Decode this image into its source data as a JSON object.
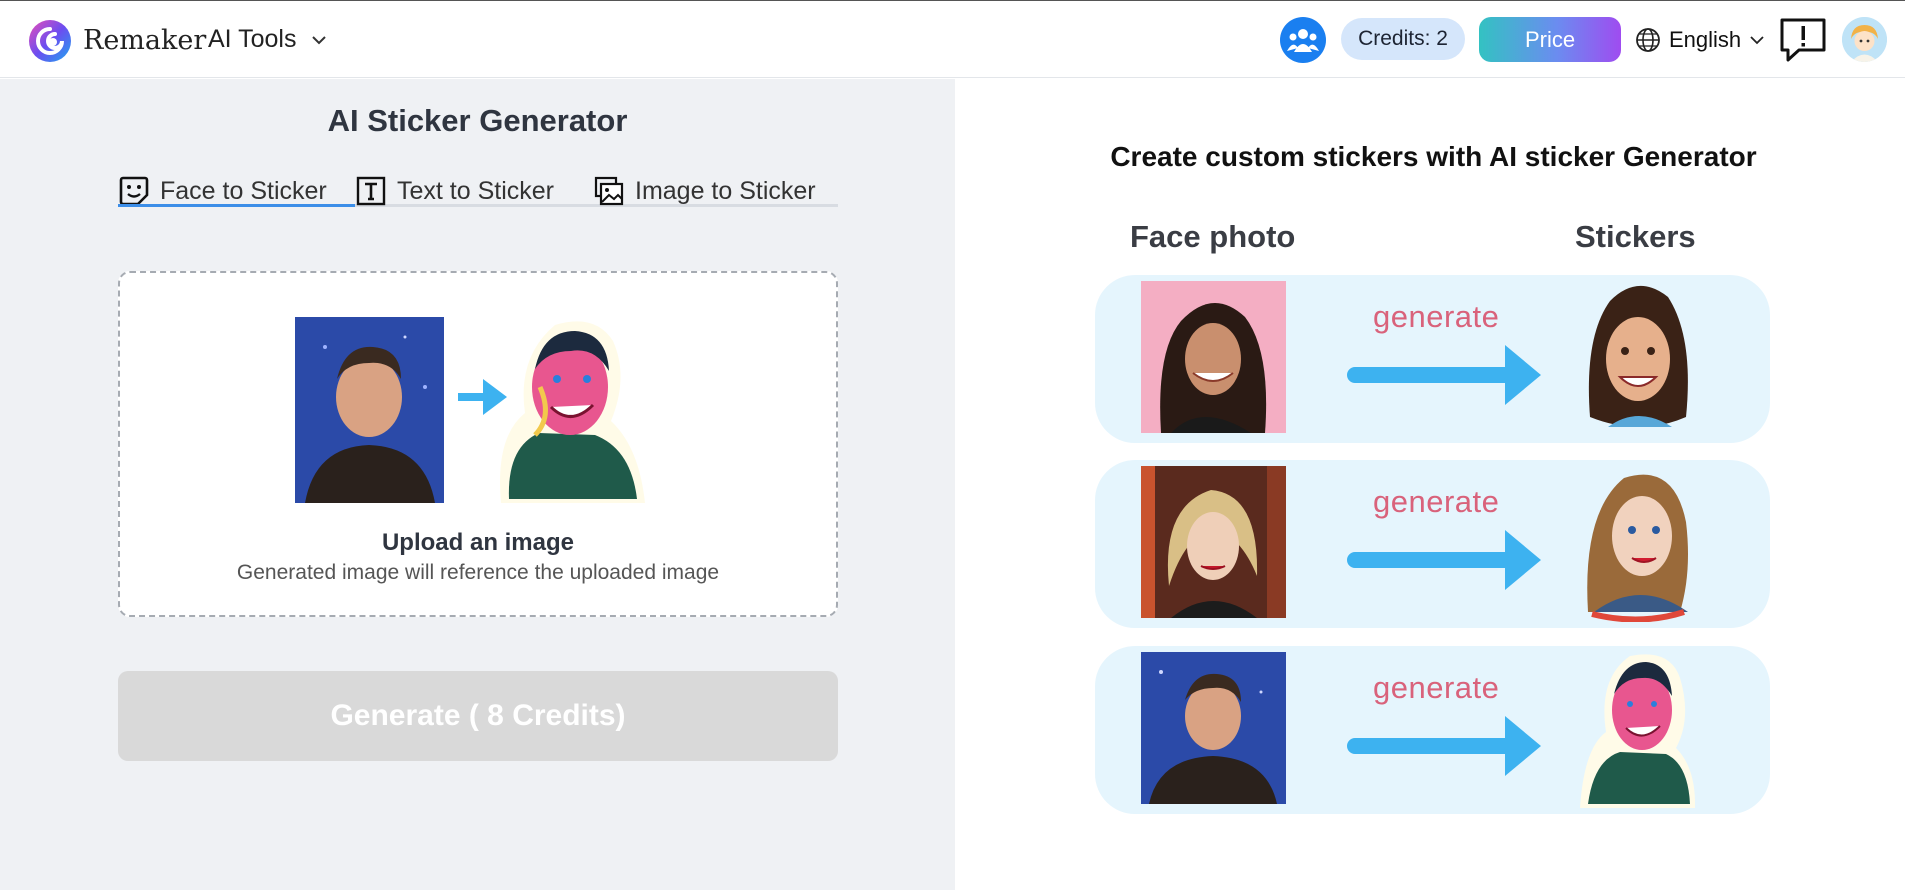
{
  "header": {
    "brand": "Remaker",
    "ai_tools_label": "AI Tools",
    "credits_label": "Credits: 2",
    "price_label": "Price",
    "language_label": "English",
    "colors": {
      "accent_blue": "#1a7ff0",
      "credits_bg": "#d5e6fb",
      "price_gradient_start": "#33c2c2",
      "price_gradient_end": "#9f4cf0"
    }
  },
  "left": {
    "title": "AI Sticker Generator",
    "tabs": [
      {
        "label": "Face to Sticker",
        "icon": "face-sticker-icon",
        "active": true
      },
      {
        "label": "Text to Sticker",
        "icon": "text-box-icon",
        "active": false
      },
      {
        "label": "Image to Sticker",
        "icon": "image-stack-icon",
        "active": false
      }
    ],
    "upload": {
      "title": "Upload an image",
      "subtitle": "Generated image will reference the uploaded image"
    },
    "generate_label": "Generate ( 8 Credits)"
  },
  "right": {
    "title": "Create custom stickers with AI sticker Generator",
    "col_left": "Face photo",
    "col_right": "Stickers",
    "examples": [
      {
        "label": "generate"
      },
      {
        "label": "generate"
      },
      {
        "label": "generate"
      }
    ],
    "colors": {
      "row_bg": "#e5f5fd",
      "arrow": "#3db2f0",
      "generate_text": "#d9627b"
    }
  }
}
